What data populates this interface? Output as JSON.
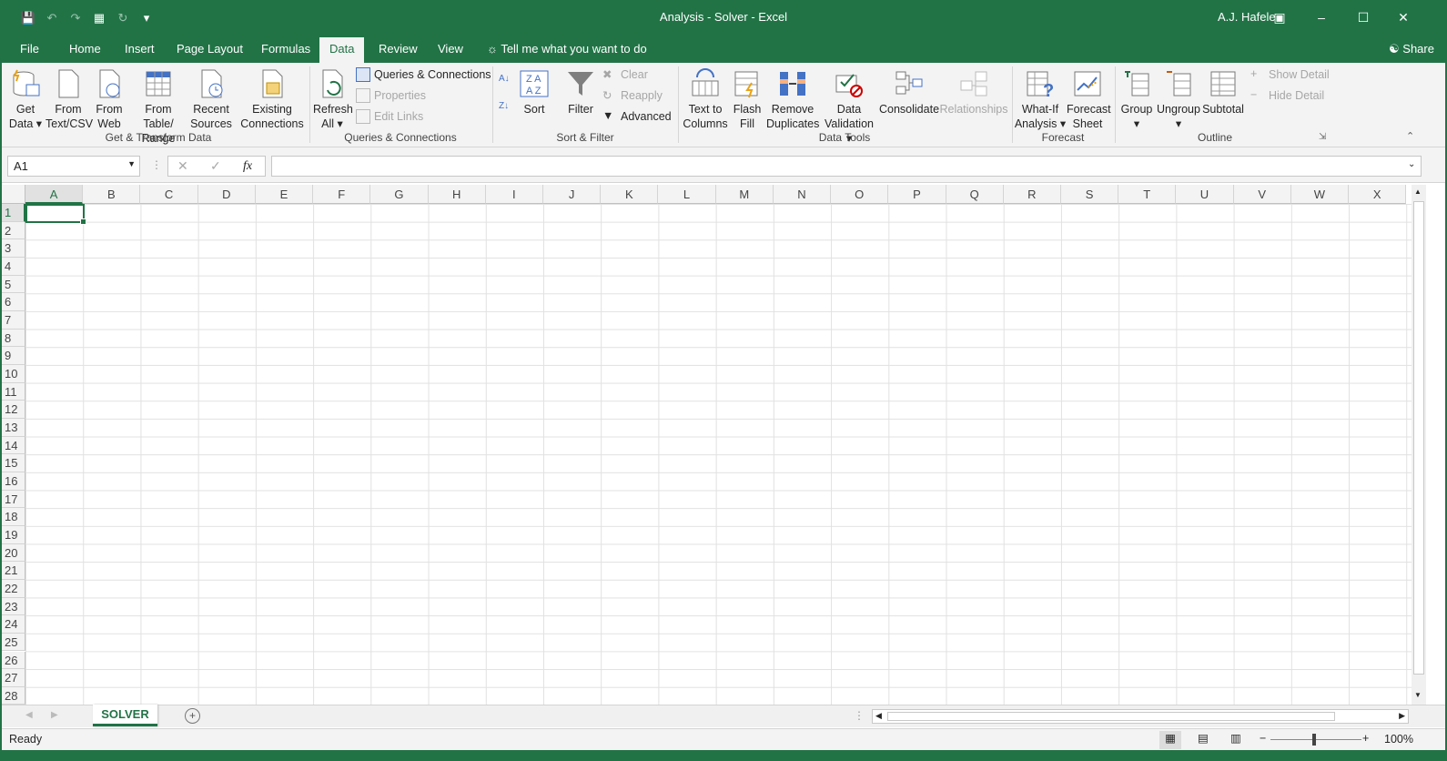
{
  "window": {
    "title": "Analysis - Solver  -  Excel",
    "user": "A.J. Hafele"
  },
  "tabs": [
    "File",
    "Home",
    "Insert",
    "Page Layout",
    "Formulas",
    "Data",
    "Review",
    "View"
  ],
  "tell_me": "Tell me what you want to do",
  "share": "Share",
  "ribbon": {
    "get_data": [
      "Get",
      "Data"
    ],
    "from_text": [
      "From",
      "Text/CSV"
    ],
    "from_web": [
      "From",
      "Web"
    ],
    "from_table": [
      "From Table/",
      "Range"
    ],
    "recent_sources": [
      "Recent",
      "Sources"
    ],
    "existing_connections": [
      "Existing",
      "Connections"
    ],
    "group1": "Get & Transform Data",
    "refresh_all": [
      "Refresh",
      "All"
    ],
    "queries_connections": "Queries & Connections",
    "properties": "Properties",
    "edit_links": "Edit Links",
    "group2": "Queries & Connections",
    "sort": "Sort",
    "filter": "Filter",
    "clear": "Clear",
    "reapply": "Reapply",
    "advanced": "Advanced",
    "group3": "Sort & Filter",
    "text_to_columns": [
      "Text to",
      "Columns"
    ],
    "flash_fill": [
      "Flash",
      "Fill"
    ],
    "remove_duplicates": [
      "Remove",
      "Duplicates"
    ],
    "data_validation": [
      "Data",
      "Validation"
    ],
    "consolidate": "Consolidate",
    "relationships": "Relationships",
    "group4": "Data Tools",
    "what_if": [
      "What-If",
      "Analysis"
    ],
    "forecast_sheet": [
      "Forecast",
      "Sheet"
    ],
    "group5": "Forecast",
    "group_btn": "Group",
    "ungroup": "Ungroup",
    "subtotal": "Subtotal",
    "show_detail": "Show Detail",
    "hide_detail": "Hide Detail",
    "group6": "Outline"
  },
  "namebox": "A1",
  "fx": "fx",
  "columns": [
    "A",
    "B",
    "C",
    "D",
    "E",
    "F",
    "G",
    "H",
    "I",
    "J",
    "K",
    "L",
    "M",
    "N",
    "O",
    "P",
    "Q",
    "R",
    "S",
    "T",
    "U",
    "V",
    "W",
    "X"
  ],
  "rows": [
    "1",
    "2",
    "3",
    "4",
    "5",
    "6",
    "7",
    "8",
    "9",
    "10",
    "11",
    "12",
    "13",
    "14",
    "15",
    "16",
    "17",
    "18",
    "19",
    "20",
    "21",
    "22",
    "23",
    "24",
    "25",
    "26",
    "27",
    "28"
  ],
  "sheet": "SOLVER",
  "status": "Ready",
  "zoom": "100%",
  "colors": {
    "accent": "#217346"
  }
}
